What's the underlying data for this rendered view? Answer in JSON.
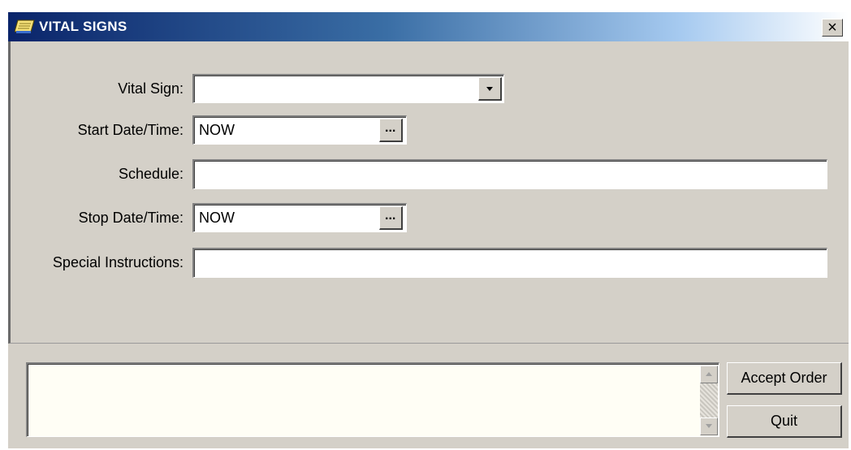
{
  "window": {
    "title": "VITAL SIGNS",
    "close_glyph": "×",
    "icon": "notepad-icon"
  },
  "form": {
    "vital_sign": {
      "label": "Vital Sign:",
      "value": "",
      "dropdown_icon": "chevron-down-icon"
    },
    "start_datetime": {
      "label": "Start Date/Time:",
      "value": "NOW",
      "button_label": "..."
    },
    "schedule": {
      "label": "Schedule:",
      "value": ""
    },
    "stop_datetime": {
      "label": "Stop Date/Time:",
      "value": "NOW",
      "button_label": "..."
    },
    "special_instructions": {
      "label": "Special Instructions:",
      "value": ""
    }
  },
  "order_text": {
    "value": "",
    "scroll_up_icon": "arrow-up-icon",
    "scroll_down_icon": "arrow-down-icon"
  },
  "buttons": {
    "accept_label": "Accept Order",
    "quit_label": "Quit"
  }
}
